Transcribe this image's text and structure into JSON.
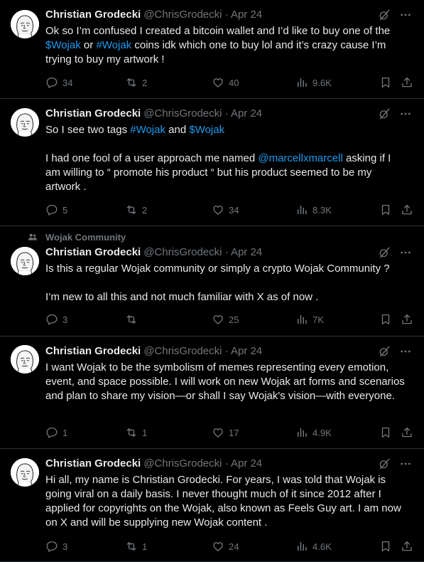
{
  "posts": [
    {
      "author": "Christian Grodecki",
      "meta": "@ChrisGrodecki · Apr 24",
      "community": "",
      "text": [
        {
          "t": "Ok so I’m confused I created a bitcoin wallet and I’d like to buy one of the "
        },
        {
          "t": "$Wojak",
          "link": true
        },
        {
          "t": " or "
        },
        {
          "t": "#Wojak",
          "link": true
        },
        {
          "t": " coins idk which one to buy lol and it’s crazy cause I’m trying to buy my artwork !"
        }
      ],
      "replies": "34",
      "reposts": "2",
      "likes": "40",
      "views": "9.6K"
    },
    {
      "author": "Christian Grodecki",
      "meta": "@ChrisGrodecki · Apr 24",
      "community": "",
      "text": [
        {
          "t": "So I see two tags "
        },
        {
          "t": "#Wojak",
          "link": true
        },
        {
          "t": " and "
        },
        {
          "t": "$Wojak",
          "link": true
        },
        {
          "t": "\n\nI had one fool of a user approach me named "
        },
        {
          "t": "@marcellxmarcell",
          "link": true
        },
        {
          "t": " asking if I am willing to “ promote his product “ but his product seemed to be my artwork ."
        }
      ],
      "replies": "5",
      "reposts": "2",
      "likes": "34",
      "views": "8.3K"
    },
    {
      "author": "Christian Grodecki",
      "meta": "@ChrisGrodecki · Apr 24",
      "community": "Wojak Community",
      "text": [
        {
          "t": "Is this a regular Wojak community or simply a crypto Wojak Community ?\n\nI’m new to all this and not much familiar with X as of now ."
        }
      ],
      "replies": "3",
      "reposts": "",
      "likes": "25",
      "views": "7K"
    },
    {
      "author": "Christian Grodecki",
      "meta": "@ChrisGrodecki · Apr 24",
      "community": "",
      "text": [
        {
          "t": "I want Wojak to be the symbolism of memes representing every emotion, event, and space possible. I will work on new Wojak art forms and scenarios and plan to share my vision—or shall I say Wojak's vision—with everyone."
        }
      ],
      "replies": "1",
      "reposts": "1",
      "likes": "17",
      "views": "4.9K"
    },
    {
      "author": "Christian Grodecki",
      "meta": "@ChrisGrodecki · Apr 24",
      "community": "",
      "text": [
        {
          "t": "Hi all, my name is Christian Grodecki. For years, I was told that Wojak is going viral on a daily basis. I never thought much of it since 2012 after I applied for copyrights on the Wojak, also known as Feels Guy art. I am now on X and will be supplying new Wojak content ."
        }
      ],
      "replies": "3",
      "reposts": "1",
      "likes": "24",
      "views": "4.6K"
    }
  ],
  "icons": {
    "reply": "reply-icon",
    "repost": "repost-icon",
    "like": "like-icon",
    "views": "views-icon",
    "bookmark": "bookmark-icon",
    "share": "share-icon",
    "grok": "grok-icon",
    "more": "more-icon",
    "community": "community-icon"
  },
  "colors": {
    "background": "#000000",
    "text": "#e7e9ea",
    "muted": "#71767b",
    "link": "#1d9bf0",
    "divider": "#2f3336"
  }
}
